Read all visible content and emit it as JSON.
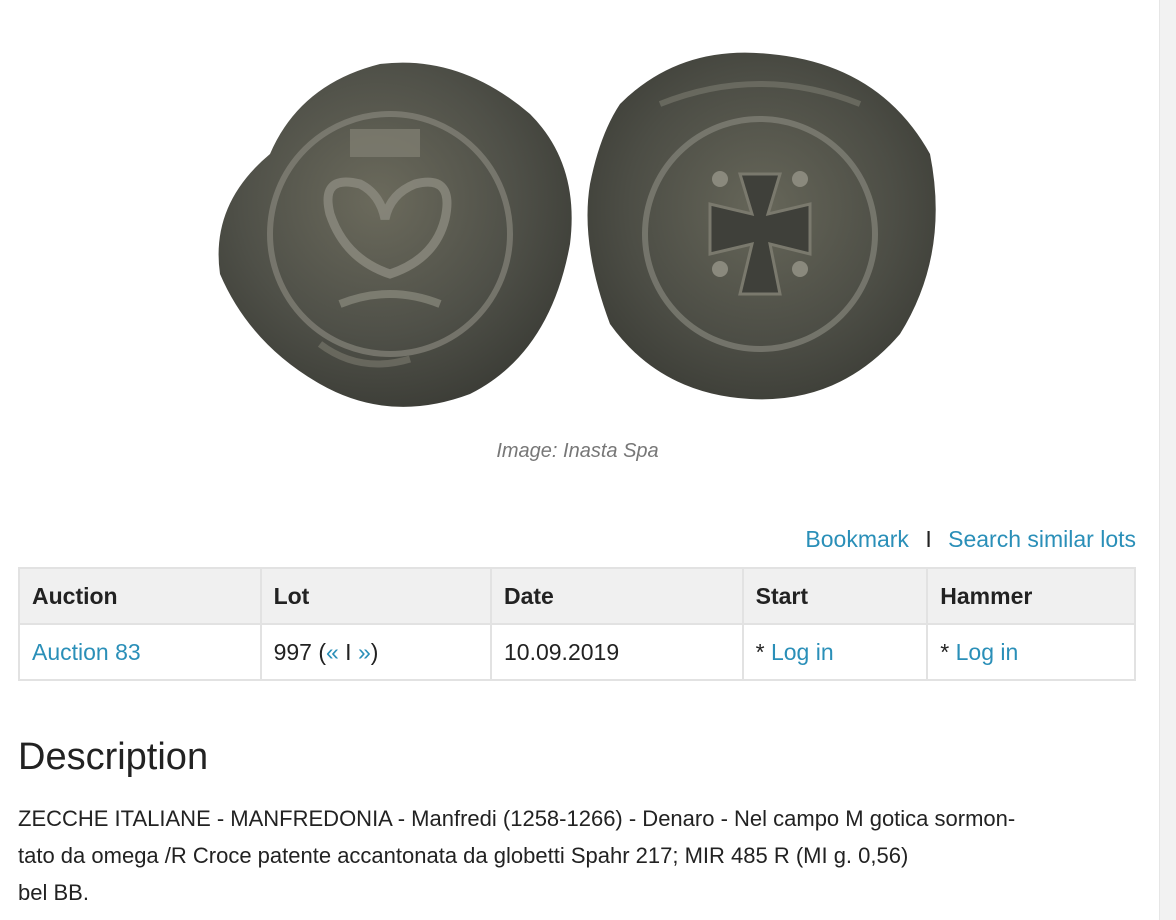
{
  "image": {
    "caption": "Image: Inasta Spa"
  },
  "actions": {
    "bookmark": "Bookmark",
    "separator": "I",
    "search_similar": "Search similar lots"
  },
  "table": {
    "headers": {
      "auction": "Auction",
      "lot": "Lot",
      "date": "Date",
      "start": "Start",
      "hammer": "Hammer"
    },
    "row": {
      "auction": "Auction 83",
      "lot_number": "997 (",
      "prev": "«",
      "lot_sep": " I ",
      "next": "»",
      "lot_close": ")",
      "date": "10.09.2019",
      "start_prefix": "* ",
      "start_link": "Log in",
      "hammer_prefix": "* ",
      "hammer_link": "Log in"
    }
  },
  "description": {
    "title": "Description",
    "line1": "ZECCHE ITALIANE - MANFREDONIA - Manfredi (1258-1266) - Denaro - Nel campo M gotica sormon-",
    "line2": "tato da omega /R Croce patente accantonata da globetti Spahr 217; MIR 485 R (MI g. 0,56)",
    "line3": "bel BB."
  },
  "colors": {
    "link": "#2a8fb8",
    "header_bg": "#f0f0f0",
    "border": "#e2e2e2"
  }
}
